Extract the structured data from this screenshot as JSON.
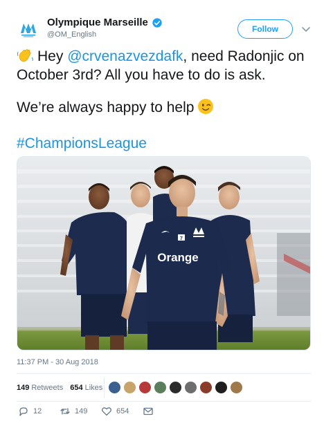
{
  "account": {
    "display_name": "Olympique Marseille",
    "handle": "@OM_English",
    "follow_label": "Follow"
  },
  "tweet": {
    "line1_pre": "Hey ",
    "mention": "@crvenazvezdafk",
    "line1_post": ", need Radonjic on",
    "line1b": "October 3rd? All you have to do is ask.",
    "line2": "We’re always happy to help",
    "hashtag": "#ChampionsLeague",
    "shirt_sponsor": "Orange",
    "shirt_number": "7"
  },
  "meta": {
    "timestamp": "11:37 PM - 30 Aug 2018",
    "retweets_count": "149",
    "retweets_label": "Retweets",
    "likes_count": "654",
    "likes_label": "Likes"
  },
  "actions": {
    "reply_count": "12",
    "retweet_count": "149",
    "like_count": "654"
  },
  "colors": {
    "link": "#1b95e0",
    "follow": "#1da1f2",
    "muted": "#657786",
    "shirt": "#1c2a4d"
  },
  "icons": [
    "wave-emoji",
    "wink-emoji",
    "verified-badge-icon",
    "chevron-down-icon",
    "reply-icon",
    "retweet-icon",
    "like-icon",
    "direct-message-icon"
  ]
}
